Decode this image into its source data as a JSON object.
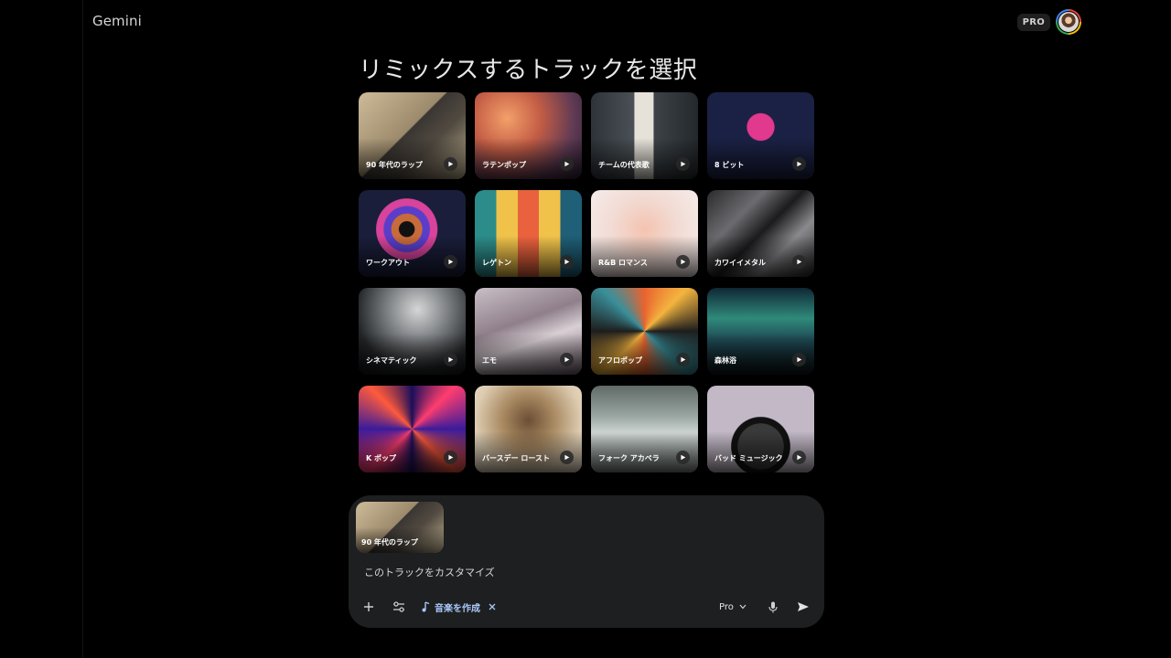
{
  "app": {
    "title": "Gemini"
  },
  "header": {
    "plan_badge": "PRO",
    "avatar_icon": "user-avatar"
  },
  "main": {
    "title": "リミックスするトラックを選択",
    "tracks": [
      {
        "label": "90 年代のラップ"
      },
      {
        "label": "ラテンポップ"
      },
      {
        "label": "チームの代表歌"
      },
      {
        "label": "8 ビット"
      },
      {
        "label": "ワークアウト"
      },
      {
        "label": "レゲトン"
      },
      {
        "label": "R&B ロマンス"
      },
      {
        "label": "カワイイメタル"
      },
      {
        "label": "シネマティック"
      },
      {
        "label": "エモ"
      },
      {
        "label": "アフロポップ"
      },
      {
        "label": "森林浴"
      },
      {
        "label": "K ポップ"
      },
      {
        "label": "バースデー ロースト"
      },
      {
        "label": "フォーク アカペラ"
      },
      {
        "label": "バッド ミュージック"
      }
    ]
  },
  "composer": {
    "selected_track": "90 年代のラップ",
    "prompt": "このトラックをカスタマイズ",
    "music_tool_label": "音楽を作成",
    "model": "Pro",
    "accent_color": "#a8c7fa"
  }
}
